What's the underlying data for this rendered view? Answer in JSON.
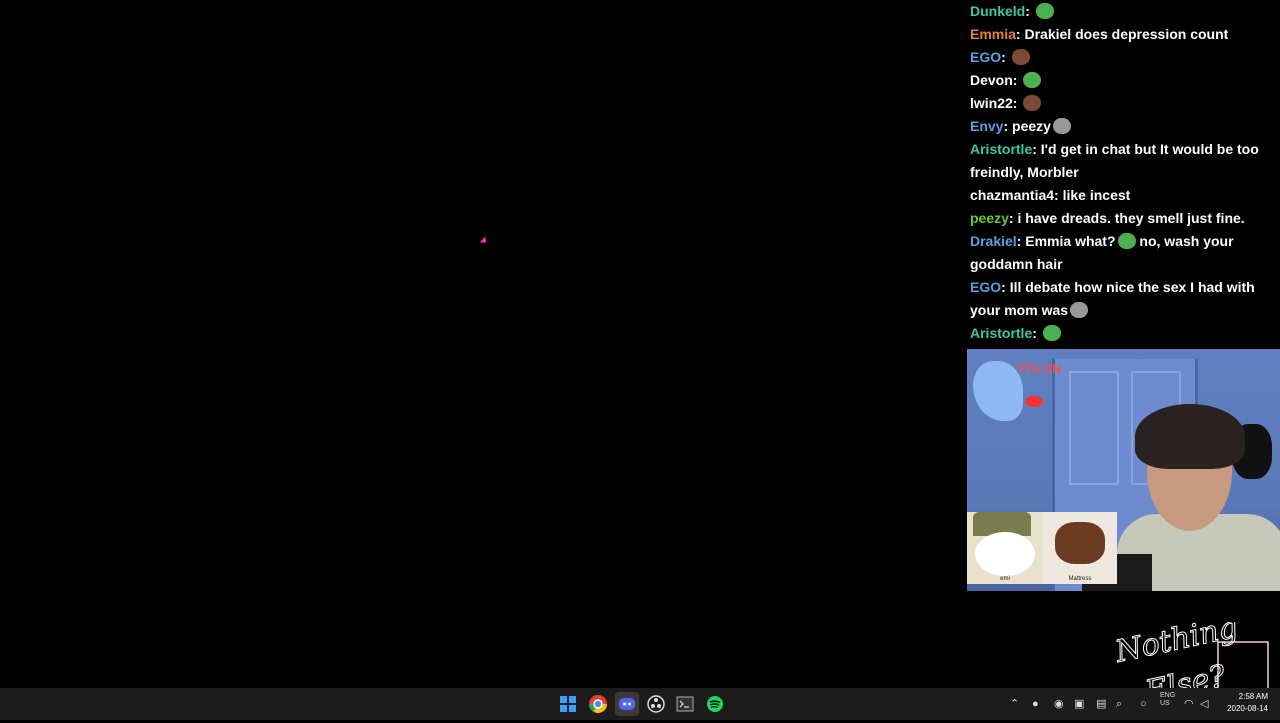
{
  "chat": {
    "messages": [
      {
        "user": "Dunkeld",
        "color": "#3ec7a4",
        "text": "",
        "emote": "pepe-emote"
      },
      {
        "user": "Emmia",
        "color": "#e0803a",
        "text": "Drakiel does depression count",
        "emote": ""
      },
      {
        "user": "EGO",
        "color": "#5aa0e0",
        "text": "",
        "emote": "face-emote"
      },
      {
        "user": "Devon",
        "color": "#ffffff",
        "text": "",
        "emote": "pepe-emote"
      },
      {
        "user": "lwin22",
        "color": "#ffffff",
        "text": "",
        "emote": "face-emote"
      },
      {
        "user": "Envy",
        "color": "#5aa0e0",
        "text": "peezy",
        "emote": "gun-emote"
      },
      {
        "user": "Aristortle",
        "color": "#3ec7a4",
        "text": "I'd get in chat but It would be too freindly, Morbler",
        "emote": ""
      },
      {
        "user": "chazmantia4",
        "color": "#ffffff",
        "text": "like incest",
        "emote": ""
      },
      {
        "user": "peezy",
        "color": "#6ac53a",
        "text": "i have dreads. they smell just fine.",
        "emote": ""
      },
      {
        "user": "Drakiel",
        "color": "#5aa0e0",
        "text": "Emmia what?",
        "emote": "pepe-emote",
        "text_after": "no, wash your goddamn hair"
      },
      {
        "user": "EGO",
        "color": "#5aa0e0",
        "text": "Ill debate how nice the sex I had with your mom was",
        "emote": "gun-emote"
      },
      {
        "user": "Aristortle",
        "color": "#3ec7a4",
        "text": "",
        "emote": "pepe-emote"
      }
    ]
  },
  "webcam": {
    "tts_label": "TTS ON",
    "avatar1_label": "emi",
    "avatar2_label": "Mattress"
  },
  "logo": {
    "text_line1": "Nothing",
    "text_line2": "Else?"
  },
  "taskbar": {
    "icons": [
      "windows-start",
      "chrome",
      "discord",
      "obs",
      "terminal",
      "spotify"
    ],
    "language": "ENG",
    "region": "US",
    "time": "2:58 AM",
    "date": "2020-08-14"
  }
}
